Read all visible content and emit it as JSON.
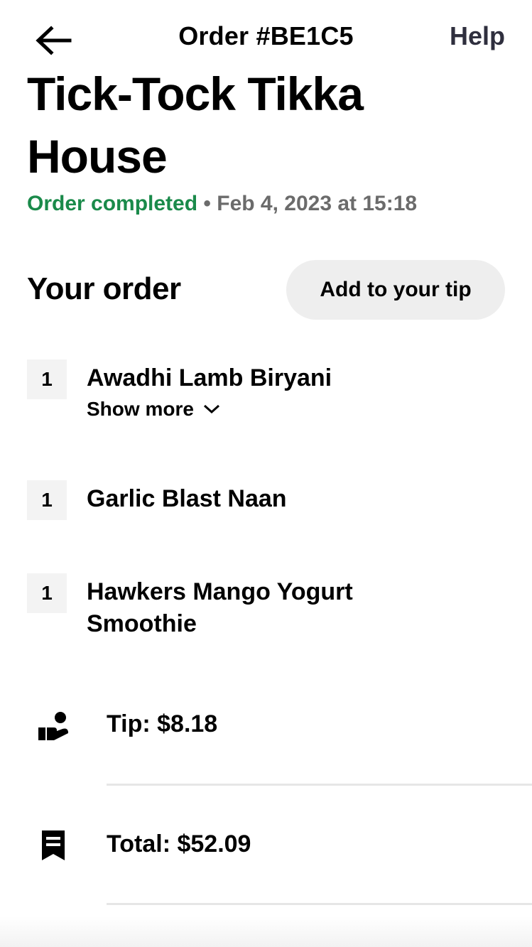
{
  "header": {
    "order_number": "Order #BE1C5",
    "help_label": "Help"
  },
  "restaurant": {
    "name": "Tick-Tock Tikka House"
  },
  "status": {
    "state": "Order completed",
    "separator": " • ",
    "date": "Feb 4, 2023 at 15:18",
    "state_color": "#1a8a4a"
  },
  "order": {
    "section_title": "Your order",
    "add_tip_label": "Add to your tip",
    "items": [
      {
        "qty": "1",
        "name": "Awadhi Lamb Biryani",
        "show_more": "Show more"
      },
      {
        "qty": "1",
        "name": "Garlic Blast Naan"
      },
      {
        "qty": "1",
        "name": "Hawkers Mango Yogurt Smoothie"
      }
    ]
  },
  "summary": {
    "tip": {
      "icon": "hand-coin-icon",
      "text": "Tip: $8.18"
    },
    "total": {
      "icon": "receipt-icon",
      "text": "Total: $52.09"
    }
  }
}
